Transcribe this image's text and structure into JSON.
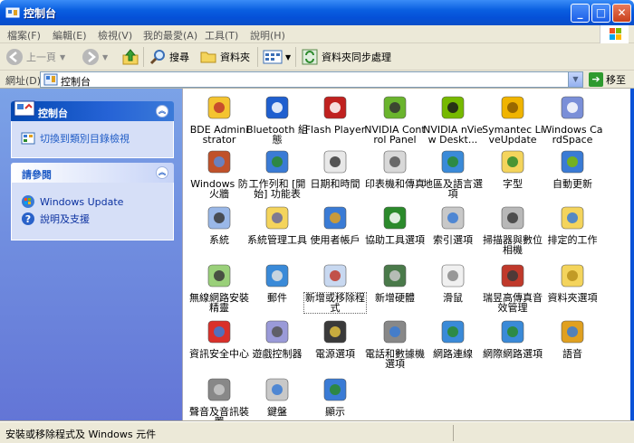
{
  "window": {
    "title": "控制台"
  },
  "menu": [
    "檔案(F)",
    "編輯(E)",
    "檢視(V)",
    "我的最愛(A)",
    "工具(T)",
    "說明(H)"
  ],
  "toolbar": {
    "back": "上一頁",
    "search": "搜尋",
    "folders": "資料夾",
    "sync": "資料夾同步處理"
  },
  "address": {
    "label": "網址(D)",
    "value": "控制台",
    "go": "移至"
  },
  "sidebar": {
    "panel1": {
      "title": "控制台",
      "tasks": [
        "切換到類別目錄檢視"
      ]
    },
    "panel2": {
      "title": "請參閱",
      "links": [
        "Windows Update",
        "說明及支援"
      ]
    }
  },
  "items": [
    {
      "label": "BDE Administrator",
      "icon": "bde-icon"
    },
    {
      "label": "Bluetooth 組態",
      "icon": "bluetooth-icon"
    },
    {
      "label": "Flash Player",
      "icon": "flash-icon"
    },
    {
      "label": "NVIDIA Control Panel",
      "icon": "nvidia-panel-icon"
    },
    {
      "label": "NVIDIA nView Deskt...",
      "icon": "nvidia-nview-icon"
    },
    {
      "label": "Symantec LiveUpdate",
      "icon": "symantec-icon"
    },
    {
      "label": "Windows CardSpace",
      "icon": "cardspace-icon"
    },
    {
      "label": "Windows 防火牆",
      "icon": "firewall-icon"
    },
    {
      "label": "工作列和 [開始] 功能表",
      "icon": "taskbar-icon"
    },
    {
      "label": "日期和時間",
      "icon": "datetime-icon"
    },
    {
      "label": "印表機和傳真",
      "icon": "printer-icon"
    },
    {
      "label": "地區及語言選項",
      "icon": "globe-icon"
    },
    {
      "label": "字型",
      "icon": "fonts-icon"
    },
    {
      "label": "自動更新",
      "icon": "windows-update-icon"
    },
    {
      "label": "系統",
      "icon": "system-icon"
    },
    {
      "label": "系統管理工具",
      "icon": "admin-tools-icon"
    },
    {
      "label": "使用者帳戶",
      "icon": "users-icon"
    },
    {
      "label": "協助工具選項",
      "icon": "accessibility-icon"
    },
    {
      "label": "索引選項",
      "icon": "index-icon"
    },
    {
      "label": "掃描器與數位相機",
      "icon": "scanner-icon"
    },
    {
      "label": "排定的工作",
      "icon": "scheduled-tasks-icon"
    },
    {
      "label": "無線網路安裝精靈",
      "icon": "wireless-icon"
    },
    {
      "label": "郵件",
      "icon": "mail-icon"
    },
    {
      "label": "新增或移除程式",
      "icon": "add-remove-icon"
    },
    {
      "label": "新增硬體",
      "icon": "add-hardware-icon"
    },
    {
      "label": "滑鼠",
      "icon": "mouse-icon"
    },
    {
      "label": "瑞昱高傳真音效管理",
      "icon": "realtek-icon"
    },
    {
      "label": "資料夾選項",
      "icon": "folder-options-icon"
    },
    {
      "label": "資訊安全中心",
      "icon": "security-center-icon"
    },
    {
      "label": "遊戲控制器",
      "icon": "gamepad-icon"
    },
    {
      "label": "電源選項",
      "icon": "power-icon"
    },
    {
      "label": "電話和數據機選項",
      "icon": "phone-modem-icon"
    },
    {
      "label": "網路連線",
      "icon": "network-icon"
    },
    {
      "label": "網際網路選項",
      "icon": "internet-options-icon"
    },
    {
      "label": "語音",
      "icon": "speech-icon"
    },
    {
      "label": "聲音及音訊裝置",
      "icon": "sound-icon"
    },
    {
      "label": "鍵盤",
      "icon": "keyboard-icon"
    },
    {
      "label": "顯示",
      "icon": "display-icon"
    }
  ],
  "status": {
    "text": "安裝或移除程式及 Windows 元件"
  }
}
